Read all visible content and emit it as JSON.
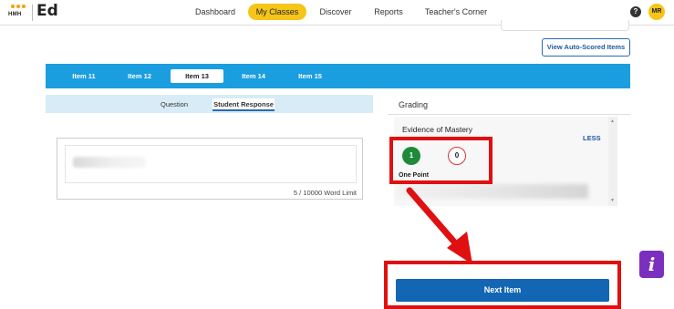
{
  "header": {
    "brand": "Ed",
    "logo_text": "HMH",
    "logo_dot_colors": [
      "#f5a000",
      "#f5a000",
      "#f5a000"
    ],
    "nav": [
      {
        "label": "Dashboard",
        "active": false
      },
      {
        "label": "My Classes",
        "active": true
      },
      {
        "label": "Discover",
        "active": false
      },
      {
        "label": "Reports",
        "active": false
      },
      {
        "label": "Teacher's Corner",
        "active": false
      }
    ],
    "help_icon": "?",
    "avatar_initials": "MR"
  },
  "toolbar": {
    "auto_scored_label": "View Auto-Scored Items"
  },
  "items": {
    "tabs": [
      "Item 11",
      "Item 12",
      "Item 13",
      "Item 14",
      "Item 15"
    ],
    "active": "Item 13"
  },
  "left_panel": {
    "subtabs": [
      "Question",
      "Student Response"
    ],
    "active_subtab": "Student Response",
    "word_limit": "5 / 10000 Word Limit"
  },
  "grading": {
    "title": "Grading",
    "section_title": "Evidence of Mastery",
    "less_label": "LESS",
    "scores": [
      "1",
      "0"
    ],
    "selected_score": "1",
    "score_caption": "One Point"
  },
  "footer": {
    "next_label": "Next Item",
    "info_label": "i"
  },
  "colors": {
    "accent_yellow": "#f5c518",
    "tab_bar_blue": "#1a9ee0",
    "button_blue": "#1366b3",
    "annotation_red": "#e01010",
    "score_green": "#1e8a3a",
    "info_purple": "#7b2fbe"
  }
}
